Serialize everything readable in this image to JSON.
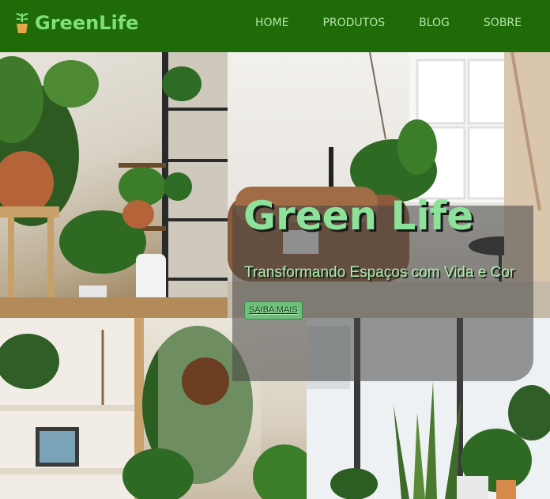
{
  "brand": {
    "name": "GreenLife",
    "icon": "potted-plant-icon",
    "color": "#7fe07b"
  },
  "nav": {
    "items": [
      {
        "label": "HOME"
      },
      {
        "label": "PRODUTOS"
      },
      {
        "label": "BLOG"
      },
      {
        "label": "SOBRE"
      }
    ]
  },
  "hero": {
    "title": "Green Life",
    "subtitle": "Transformando Espaços com Vida e Cor",
    "cta_label": "SAIBA MAIS"
  },
  "colors": {
    "header_bg": "#1e6b08",
    "accent": "#6cc07a"
  }
}
